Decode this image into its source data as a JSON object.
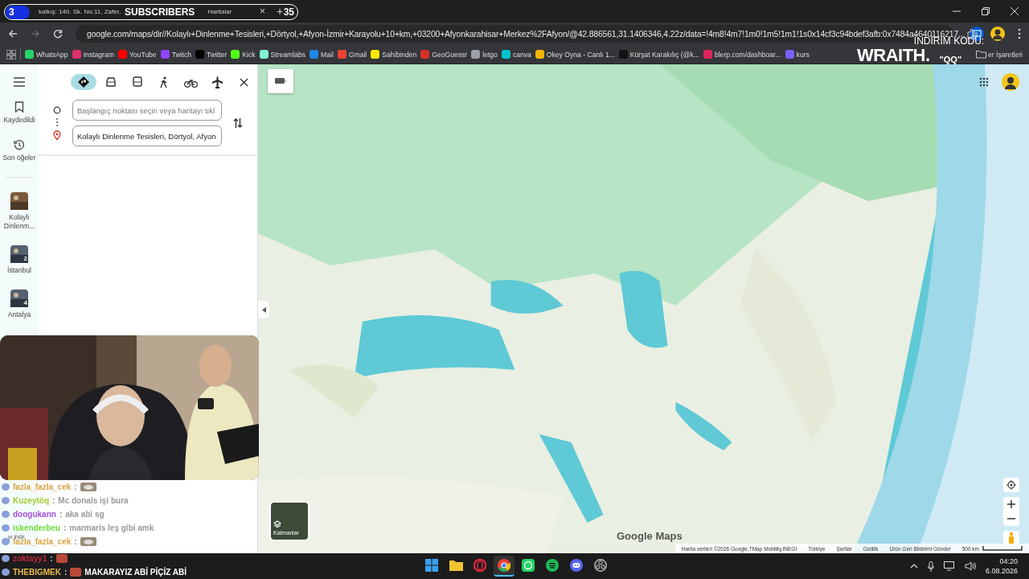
{
  "stream_overlay": {
    "subscriber_goal": {
      "current": "3",
      "label": "SUBSCRIBERS",
      "goal": "35"
    },
    "promo": {
      "label": "İNDİRİM KODU:",
      "brand": "WRAITH.",
      "code": "\"QQ\""
    }
  },
  "browser": {
    "tab": {
      "title_start": "kalkış: 140. Sk. No:11, Zafer,",
      "title_end": "Haritalar",
      "close": "×"
    },
    "new_tab": "+",
    "url": "google.com/maps/dir//Kolaylı+Dinlenme+Tesisleri,+Dörtyol,+Afyon-İzmir+Karayolu+10+km,+03200+Afyonkarahisar+Merkez%2FAfyon/@42.886561,31.1406346,4.22z/data=!4m8!4m7!1m0!1m5!1m1!1s0x14cf3c94bdef3afb:0x7484a4640116217...",
    "bookmarks": [
      {
        "label": "WhatsApp",
        "color": "#25d366"
      },
      {
        "label": "Instagram",
        "color": "#e1306c"
      },
      {
        "label": "YouTube",
        "color": "#ff0000"
      },
      {
        "label": "Twitch",
        "color": "#9146ff"
      },
      {
        "label": "Twitter",
        "color": "#000000"
      },
      {
        "label": "Kick",
        "color": "#53fc18"
      },
      {
        "label": "Streamlabs",
        "color": "#80f5d2"
      },
      {
        "label": "Mail",
        "color": "#1e88e5"
      },
      {
        "label": "Gmail",
        "color": "#ea4335"
      },
      {
        "label": "Sahibinden",
        "color": "#ffe800"
      },
      {
        "label": "GeoGuessr",
        "color": "#d93025"
      },
      {
        "label": "letgo",
        "color": "#9aa0a6"
      },
      {
        "label": "canva",
        "color": "#00c4cc"
      },
      {
        "label": "Okey Oyna - Canlı 1...",
        "color": "#f5b400"
      },
      {
        "label": "Kürşat Karakılıç (@k...",
        "color": "#111111"
      },
      {
        "label": "blerp.com/dashboar...",
        "color": "#e0245e"
      },
      {
        "label": "kurs",
        "color": "#7b61ff"
      }
    ],
    "other_bookmarks": "er İşaretleri"
  },
  "maps": {
    "nav": [
      {
        "label": "Kaydedildi",
        "kind": "saved"
      },
      {
        "label": "Son öğeler",
        "kind": "recent"
      }
    ],
    "recent_places": [
      {
        "label": "Kolaylı Dinlenm..."
      },
      {
        "label": "İstanbul",
        "count": "2"
      },
      {
        "label": "Antalya",
        "count": "4"
      }
    ],
    "travel_modes": [
      {
        "kind": "best",
        "selected": true
      },
      {
        "kind": "car",
        "selected": false
      },
      {
        "kind": "transit",
        "selected": false
      },
      {
        "kind": "walk",
        "selected": false
      },
      {
        "kind": "bike",
        "selected": false
      },
      {
        "kind": "flight",
        "selected": false
      }
    ],
    "origin": {
      "placeholder": "Başlangıç noktası seçin veya haritayı tıkl"
    },
    "destination": {
      "value": "Kolaylı Dinlenme Tesisleri, Dörtyol, Afyon"
    },
    "layers_button": "Katmanlar",
    "logo": "Google Maps",
    "footer": [
      "Harita verileri ©2026 Google,TMap Mobility,INEGI",
      "Türkiye",
      "Şartlar",
      "Gizlilik",
      "Ürün Geri Bildirimi Gönder"
    ],
    "scale": "500 km"
  },
  "chat": [
    {
      "user": "fazla_fazla_cek",
      "color": "#d9a441",
      "sep": ":",
      "emote": true
    },
    {
      "user": "Kuzeytöq",
      "color": "#9acd32",
      "sep": ":",
      "message": "Mc donals işi bura"
    },
    {
      "user": "doogukann",
      "color": "#a050e0",
      "sep": ":",
      "message": "aka abi sg"
    },
    {
      "user": "iskenderbeu",
      "color": "#6ddc3a",
      "sep": ":",
      "message": "marmaris leş gibi amk"
    },
    {
      "user": "fazla_fazla_cek",
      "color": "#d9a441",
      "sep": ":",
      "emote": true
    }
  ],
  "chat_notice": "yı indir",
  "chat_bottom": [
    {
      "user": "zoktayy1",
      "color": "#c0283c",
      "sep": ":",
      "emote": true
    },
    {
      "user": "THEBIGMEK",
      "color": "#e8b84a",
      "sep": ":",
      "message": "MAKARAYIZ ABİ PİÇİZ ABİ",
      "emote": true
    }
  ],
  "taskbar": {
    "apps": [
      {
        "kind": "start",
        "selected": false
      },
      {
        "kind": "files",
        "selected": false
      },
      {
        "kind": "opera",
        "selected": false
      },
      {
        "kind": "chrome",
        "selected": true
      },
      {
        "kind": "whatsapp",
        "selected": false
      },
      {
        "kind": "spotify",
        "selected": false
      },
      {
        "kind": "discord",
        "selected": false
      },
      {
        "kind": "obs",
        "selected": false
      }
    ],
    "time": "04:20",
    "date": "6.08.2026"
  }
}
